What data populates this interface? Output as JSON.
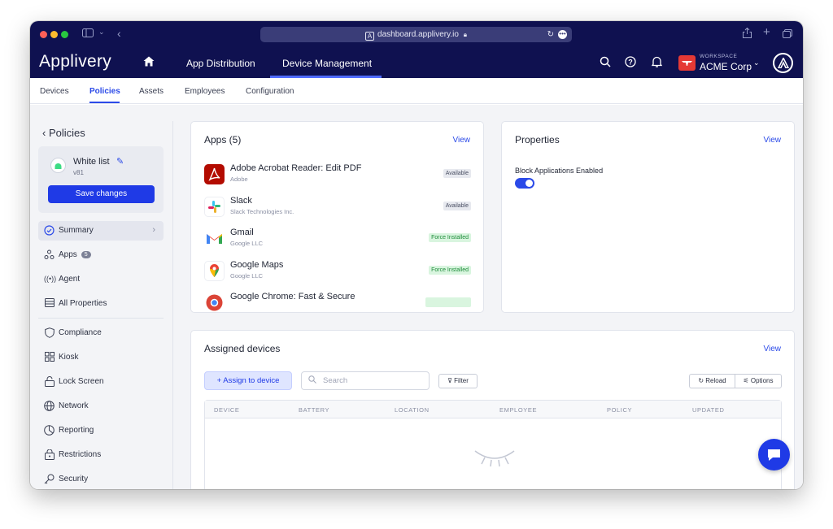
{
  "browser": {
    "url": "dashboard.applivery.io"
  },
  "navbar": {
    "logo": "Applivery",
    "tabs": [
      {
        "label": "App Distribution"
      },
      {
        "label": "Device Management"
      }
    ],
    "workspace_label": "WORKSPACE",
    "workspace_name": "ACME Corp",
    "accent": "#4f6bff"
  },
  "subtabs": [
    "Devices",
    "Policies",
    "Assets",
    "Employees",
    "Configuration"
  ],
  "sidebar": {
    "back_label": "Policies",
    "policy_name": "White list",
    "policy_version": "v81",
    "save_label": "Save changes",
    "items": [
      {
        "label": "Summary",
        "icon": "check-circle-icon"
      },
      {
        "label": "Apps",
        "count": "5",
        "icon": "apps-icon"
      },
      {
        "label": "Agent",
        "icon": "broadcast-icon"
      },
      {
        "label": "All Properties",
        "icon": "list-icon"
      },
      {
        "label": "Compliance",
        "icon": "shield-icon"
      },
      {
        "label": "Kiosk",
        "icon": "grid-icon"
      },
      {
        "label": "Lock Screen",
        "icon": "lock-icon"
      },
      {
        "label": "Network",
        "icon": "globe-icon"
      },
      {
        "label": "Reporting",
        "icon": "pie-chart-icon"
      },
      {
        "label": "Restrictions",
        "icon": "padlock-icon"
      },
      {
        "label": "Security",
        "icon": "key-icon"
      }
    ]
  },
  "apps_card": {
    "title": "Apps (5)",
    "view_label": "View",
    "apps": [
      {
        "name": "Adobe Acrobat Reader: Edit PDF",
        "publisher": "Adobe",
        "status": "Available"
      },
      {
        "name": "Slack",
        "publisher": "Slack Technologies Inc.",
        "status": "Available"
      },
      {
        "name": "Gmail",
        "publisher": "Google LLC",
        "status": "Force Installed"
      },
      {
        "name": "Google Maps",
        "publisher": "Google LLC",
        "status": "Force Installed"
      },
      {
        "name": "Google Chrome: Fast & Secure",
        "publisher": "",
        "status": ""
      }
    ]
  },
  "properties_card": {
    "title": "Properties",
    "view_label": "View",
    "property_label": "Block Applications Enabled",
    "property_enabled": true
  },
  "devices_card": {
    "title": "Assigned devices",
    "view_label": "View",
    "assign_label": "Assign to device",
    "search_placeholder": "Search",
    "filter_label": "Filter",
    "reload_label": "Reload",
    "options_label": "Options",
    "columns": [
      "DEVICE",
      "BATTERY",
      "LOCATION",
      "EMPLOYEE",
      "POLICY",
      "UPDATED"
    ]
  },
  "colors": {
    "navy": "#0f1150",
    "primary": "#1f3ae6",
    "link": "#2b4ae8",
    "success_bg": "#d9f5df",
    "success_text": "#1e8c3a"
  }
}
